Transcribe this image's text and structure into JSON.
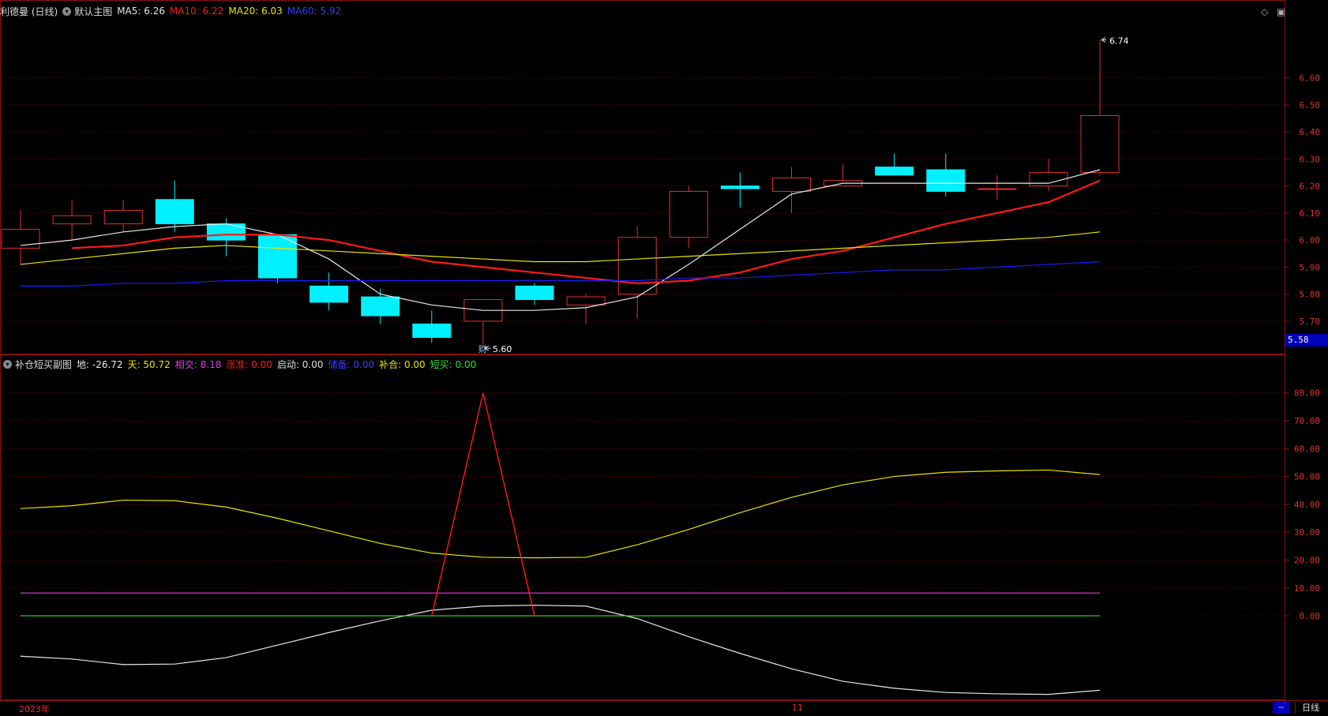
{
  "main_header": {
    "title": "利德曼 (日线)",
    "chart_name": "默认主图",
    "ma5": "MA5: 6.26",
    "ma10": "MA10: 6.22",
    "ma20": "MA20: 6.03",
    "ma60": "MA60: 5.92"
  },
  "sub_header": {
    "title": "补仓短买副图",
    "di": "地: -26.72",
    "tian": "天: 50.72",
    "xiangjiao": "相交: 8.18",
    "baozhang": "涨准: 0.00",
    "qidong": "启动: 0.00",
    "bucang": "储备: 0.00",
    "buhe": "补合: 0.00",
    "duanmai": "短买: 0.00"
  },
  "colors": {
    "up": "#e03030",
    "down": "#00f0ff",
    "ma5": "#e8e8e8",
    "ma10": "#ff1a1a",
    "ma20": "#e6e600",
    "ma60": "#1a1aff",
    "grid": "#5a0000",
    "border": "#8a1010",
    "sub_tian": "#e6e600",
    "sub_di": "#e8e8e8",
    "sub_spike": "#ff1a1a",
    "sub_magenta": "#e040e0",
    "sub_green": "#30e030"
  },
  "price_tag": "5.58",
  "bottom": {
    "year": "2023年",
    "month": "11",
    "dash": "--",
    "daily": "日线"
  },
  "annotations": {
    "high": "6.74",
    "low": "5.60",
    "cai": "财"
  },
  "icons": [
    "diamond-icon",
    "window-icon"
  ],
  "chart_data": [
    {
      "type": "candlestick",
      "ylim": [
        5.58,
        6.8
      ],
      "yticks": [
        "5.70",
        "5.80",
        "5.90",
        "6.00",
        "6.10",
        "6.20",
        "6.30",
        "6.40",
        "6.50",
        "6.60"
      ],
      "candles": [
        {
          "o": 5.97,
          "c": 6.04,
          "h": 6.11,
          "l": 5.91
        },
        {
          "o": 6.06,
          "c": 6.09,
          "h": 6.15,
          "l": 6.0
        },
        {
          "o": 6.06,
          "c": 6.11,
          "h": 6.15,
          "l": 6.03
        },
        {
          "o": 6.15,
          "c": 6.06,
          "h": 6.22,
          "l": 6.03
        },
        {
          "o": 6.06,
          "c": 6.0,
          "h": 6.08,
          "l": 5.94
        },
        {
          "o": 6.02,
          "c": 5.86,
          "h": 6.02,
          "l": 5.84
        },
        {
          "o": 5.83,
          "c": 5.77,
          "h": 5.88,
          "l": 5.74
        },
        {
          "o": 5.79,
          "c": 5.72,
          "h": 5.82,
          "l": 5.69
        },
        {
          "o": 5.69,
          "c": 5.64,
          "h": 5.74,
          "l": 5.62
        },
        {
          "o": 5.7,
          "c": 5.78,
          "h": 5.78,
          "l": 5.6
        },
        {
          "o": 5.83,
          "c": 5.78,
          "h": 5.84,
          "l": 5.76
        },
        {
          "o": 5.76,
          "c": 5.79,
          "h": 5.8,
          "l": 5.69
        },
        {
          "o": 5.8,
          "c": 6.01,
          "h": 6.05,
          "l": 5.71
        },
        {
          "o": 6.01,
          "c": 6.18,
          "h": 6.2,
          "l": 5.97
        },
        {
          "o": 6.2,
          "c": 6.19,
          "h": 6.25,
          "l": 6.12
        },
        {
          "o": 6.18,
          "c": 6.23,
          "h": 6.27,
          "l": 6.1
        },
        {
          "o": 6.2,
          "c": 6.22,
          "h": 6.28,
          "l": 6.2
        },
        {
          "o": 6.27,
          "c": 6.24,
          "h": 6.32,
          "l": 6.24
        },
        {
          "o": 6.26,
          "c": 6.18,
          "h": 6.32,
          "l": 6.16
        },
        {
          "o": 6.19,
          "c": 6.19,
          "h": 6.24,
          "l": 6.15
        },
        {
          "o": 6.2,
          "c": 6.25,
          "h": 6.3,
          "l": 6.18
        },
        {
          "o": 6.25,
          "c": 6.46,
          "h": 6.74,
          "l": 6.24
        }
      ],
      "ma_lines": {
        "ma5": [
          5.98,
          6.0,
          6.03,
          6.05,
          6.06,
          6.02,
          5.93,
          5.8,
          5.76,
          5.74,
          5.74,
          5.75,
          5.79,
          5.91,
          6.04,
          6.17,
          6.21,
          6.21,
          6.21,
          6.21,
          6.21,
          6.26
        ],
        "ma10": [
          5.97,
          5.98,
          6.01,
          6.02,
          6.02,
          6.0,
          5.96,
          5.92,
          5.9,
          5.88,
          5.86,
          5.84,
          5.85,
          5.88,
          5.93,
          5.96,
          6.01,
          6.06,
          6.1,
          6.14,
          6.22
        ],
        "ma20": [
          5.91,
          5.93,
          5.95,
          5.97,
          5.98,
          5.97,
          5.96,
          5.95,
          5.94,
          5.93,
          5.92,
          5.92,
          5.93,
          5.94,
          5.95,
          5.96,
          5.97,
          5.98,
          5.99,
          6.0,
          6.01,
          6.03
        ],
        "ma60": [
          5.83,
          5.83,
          5.84,
          5.84,
          5.85,
          5.85,
          5.85,
          5.85,
          5.85,
          5.85,
          5.85,
          5.85,
          5.85,
          5.86,
          5.86,
          5.87,
          5.88,
          5.89,
          5.89,
          5.9,
          5.91,
          5.92
        ]
      }
    },
    {
      "type": "line",
      "ylim": [
        -30,
        85
      ],
      "yticks": [
        "0.00",
        "10.00",
        "20.00",
        "30.00",
        "40.00",
        "50.00",
        "60.00",
        "70.00",
        "80.00"
      ],
      "series": [
        {
          "name": "天",
          "values": [
            38.5,
            39.5,
            41.5,
            41.3,
            39.0,
            35.0,
            30.5,
            26.0,
            22.5,
            21.0,
            20.8,
            21.0,
            25.5,
            31.0,
            37.0,
            42.5,
            47.0,
            50.0,
            51.5,
            52.0,
            52.3,
            50.7
          ]
        },
        {
          "name": "地",
          "values": [
            -14.5,
            -15.5,
            -17.5,
            -17.3,
            -15.0,
            -10.5,
            -6.0,
            -1.8,
            2.0,
            3.5,
            3.8,
            3.5,
            -1.0,
            -7.5,
            -13.5,
            -19.0,
            -23.5,
            -26.0,
            -27.5,
            -28.0,
            -28.2,
            -26.7
          ]
        },
        {
          "name": "相交",
          "values": [
            8.18,
            8.18,
            8.18,
            8.18,
            8.18,
            8.18,
            8.18,
            8.18,
            8.18,
            8.18,
            8.18,
            8.18,
            8.18,
            8.18,
            8.18,
            8.18,
            8.18,
            8.18,
            8.18,
            8.18,
            8.18,
            8.18
          ]
        },
        {
          "name": "短买",
          "values": [
            0,
            0,
            0,
            0,
            0,
            0,
            0,
            0,
            0,
            0,
            0,
            0,
            0,
            0,
            0,
            0,
            0,
            0,
            0,
            0,
            0,
            0
          ]
        }
      ],
      "spike": {
        "x_index": [
          8,
          9,
          10
        ],
        "values": [
          0,
          80,
          0
        ]
      }
    }
  ]
}
